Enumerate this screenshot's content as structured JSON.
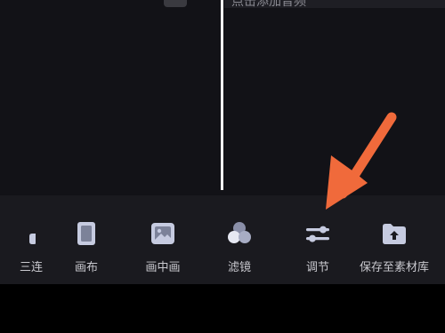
{
  "timeline": {
    "audio_strip_label": "点击添加音频"
  },
  "toolbar": {
    "items": [
      {
        "label": "三连",
        "icon": "triple-cut-icon"
      },
      {
        "label": "画布",
        "icon": "canvas-icon"
      },
      {
        "label": "画中画",
        "icon": "picture-in-picture-icon"
      },
      {
        "label": "滤镜",
        "icon": "filter-icon"
      },
      {
        "label": "调节",
        "icon": "adjust-sliders-icon"
      },
      {
        "label": "保存至素材库",
        "icon": "save-to-library-icon"
      }
    ]
  },
  "annotation": {
    "arrow_color": "#f06a3b"
  },
  "colors": {
    "toolbar_bg": "#1a1a1f",
    "icon": "#c6cbe0",
    "label": "#c9c9cf"
  }
}
